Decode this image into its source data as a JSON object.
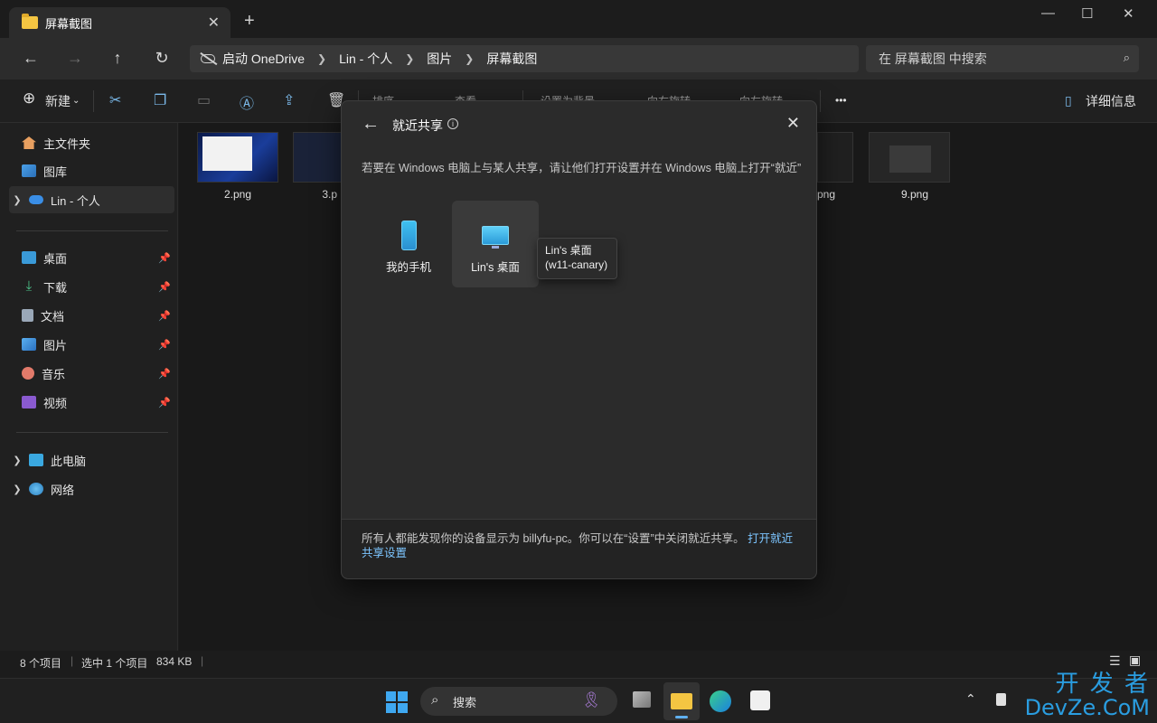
{
  "window": {
    "tab_title": "屏幕截图",
    "new_tab": "+",
    "minimize": "—",
    "maximize": "☐",
    "close": "✕"
  },
  "address": {
    "breadcrumbs": [
      "启动 OneDrive",
      "Lin - 个人",
      "图片",
      "屏幕截图"
    ],
    "search_placeholder": "在 屏幕截图 中搜索"
  },
  "commandbar": {
    "new_label": "新建",
    "faded_1": "排序",
    "faded_2": "查看",
    "faded_3": "设置为背景",
    "faded_4": "向右旋转",
    "faded_5": "向左旋转",
    "more": "•••",
    "details_label": "详细信息"
  },
  "sidebar": {
    "home": "主文件夹",
    "gallery": "图库",
    "onedrive": "Lin - 个人",
    "desktop": "桌面",
    "downloads": "下载",
    "documents": "文档",
    "pictures": "图片",
    "music": "音乐",
    "videos": "视频",
    "this_pc": "此电脑",
    "network": "网络"
  },
  "files": {
    "f1": "2.png",
    "f2": "3.p",
    "f3": "png",
    "f4": "9.png"
  },
  "status": {
    "count": "8 个项目",
    "selected": "选中 1 个项目",
    "size": "834 KB"
  },
  "dialog": {
    "title": "就近共享",
    "description": "若要在 Windows 电脑上与某人共享，请让他们打开设置并在 Windows 电脑上打开“就近”",
    "devices": [
      "我的手机",
      "Lin's 桌面"
    ],
    "tooltip_line1": "Lin's 桌面",
    "tooltip_line2": "(w11-canary)",
    "footer_text": "所有人都能发现你的设备显示为 billyfu-pc。你可以在“设置”中关闭就近共享。",
    "footer_link": "打开就近共享设置"
  },
  "taskbar": {
    "search_label": "搜索"
  },
  "watermark": {
    "line1": "开 发 者",
    "line2": "DevZe.CoM"
  },
  "colors": {
    "accent": "#7cc5ff",
    "folder": "#f4c542",
    "background": "#1c1c1c",
    "dialog": "#2b2b2b"
  }
}
